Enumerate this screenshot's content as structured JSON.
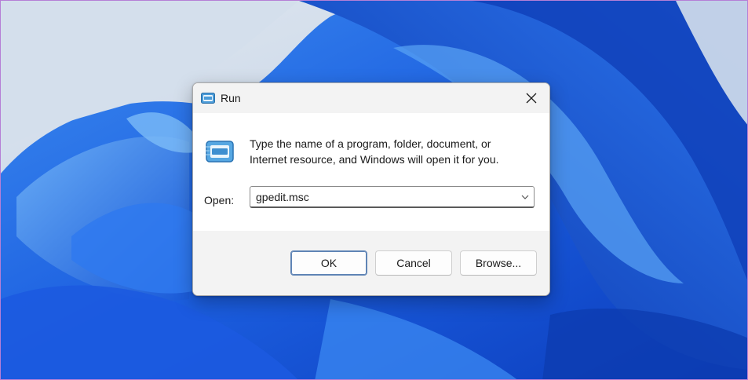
{
  "dialog": {
    "title": "Run",
    "description_line1": "Type the name of a program, folder, document, or",
    "description_line2": "Internet resource, and Windows will open it for you.",
    "open_label": "Open:",
    "open_value": "gpedit.msc",
    "buttons": {
      "ok": "OK",
      "cancel": "Cancel",
      "browse": "Browse..."
    },
    "icons": {
      "title": "run-icon",
      "close": "close-icon",
      "dropdown": "chevron-down-icon"
    }
  },
  "colors": {
    "accent": "#0067c0",
    "wallpaper_blue": "#1e63e0",
    "dialog_bg": "#ffffff",
    "bar_bg": "#f3f3f3"
  }
}
